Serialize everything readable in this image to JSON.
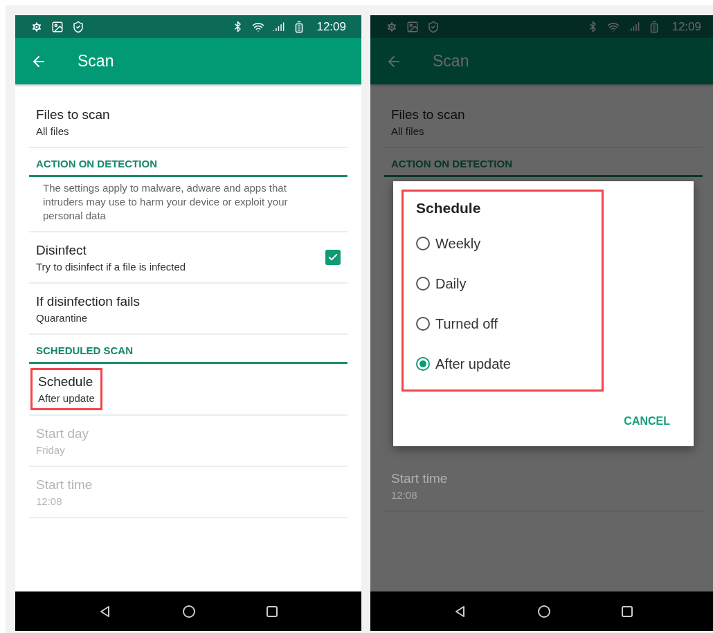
{
  "screens": [
    {
      "dimmed": false,
      "status_bar": {
        "time": "12:09"
      },
      "toolbar": {
        "title": "Scan"
      },
      "items": [
        {
          "kind": "setting",
          "title": "Files to scan",
          "value": "All files",
          "disabled": false,
          "highlighted": false
        },
        {
          "kind": "header",
          "title": "ACTION ON DETECTION"
        },
        {
          "kind": "description",
          "text": "The settings apply to malware, adware and apps that intruders may use to harm your device or exploit your personal data"
        },
        {
          "kind": "toggle",
          "title": "Disinfect",
          "value": "Try to disinfect if a file is infected",
          "checked": true
        },
        {
          "kind": "setting",
          "title": "If disinfection fails",
          "value": "Quarantine",
          "disabled": false,
          "highlighted": false
        },
        {
          "kind": "header",
          "title": "SCHEDULED SCAN"
        },
        {
          "kind": "setting",
          "title": "Schedule",
          "value": "After update",
          "disabled": false,
          "highlighted": true
        },
        {
          "kind": "setting",
          "title": "Start day",
          "value": "Friday",
          "disabled": true,
          "highlighted": false
        },
        {
          "kind": "setting",
          "title": "Start time",
          "value": "12:08",
          "disabled": true,
          "highlighted": false
        }
      ]
    },
    {
      "dimmed": true,
      "status_bar": {
        "time": "12:09"
      },
      "toolbar": {
        "title": "Scan"
      },
      "items": [
        {
          "kind": "setting",
          "title": "Files to scan",
          "value": "All files",
          "disabled": false,
          "highlighted": false
        },
        {
          "kind": "header",
          "title": "ACTION ON DETECTION"
        },
        {
          "kind": "covered"
        },
        {
          "kind": "setting",
          "title": "Start time",
          "value": "12:08",
          "disabled": true,
          "highlighted": false
        }
      ],
      "dialog": {
        "title": "Schedule",
        "highlighted": true,
        "options": [
          {
            "label": "Weekly",
            "selected": false
          },
          {
            "label": "Daily",
            "selected": false
          },
          {
            "label": "Turned off",
            "selected": false
          },
          {
            "label": "After update",
            "selected": true
          }
        ],
        "button": "CANCEL"
      }
    }
  ]
}
